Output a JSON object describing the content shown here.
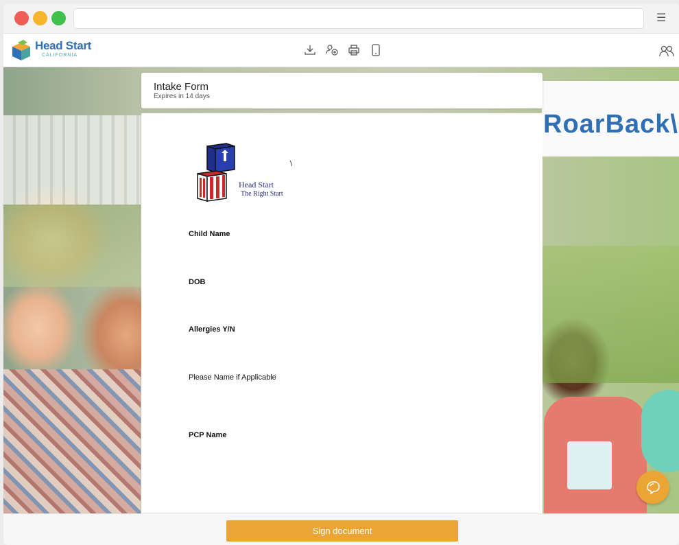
{
  "browser": {
    "url": "",
    "menu_icon": "hamburger-icon"
  },
  "app": {
    "brand_name": "Head Start",
    "brand_sub": "CALIFORNIA",
    "toolbar": [
      {
        "icon": "download-icon"
      },
      {
        "icon": "add-signer-icon"
      },
      {
        "icon": "print-icon"
      },
      {
        "icon": "mobile-icon"
      }
    ],
    "users_icon": "users-icon"
  },
  "background": {
    "banner_text": "RoarBack\\"
  },
  "form": {
    "title": "Intake Form",
    "expires": "Expires in 14 days"
  },
  "document": {
    "logo_line1": "Head Start",
    "logo_line2": "The Right Start",
    "backslash": "\\",
    "fields": [
      {
        "label": "Child Name"
      },
      {
        "label": "DOB"
      },
      {
        "label": "Allergies Y/N"
      },
      {
        "label": "Please Name if Applicable"
      },
      {
        "label": "PCP Name"
      }
    ]
  },
  "footer": {
    "sign_label": "Sign document"
  },
  "chat": {
    "icon": "chat-icon"
  },
  "colors": {
    "accent": "#eaa535",
    "brand_blue": "#2f6fb5"
  }
}
